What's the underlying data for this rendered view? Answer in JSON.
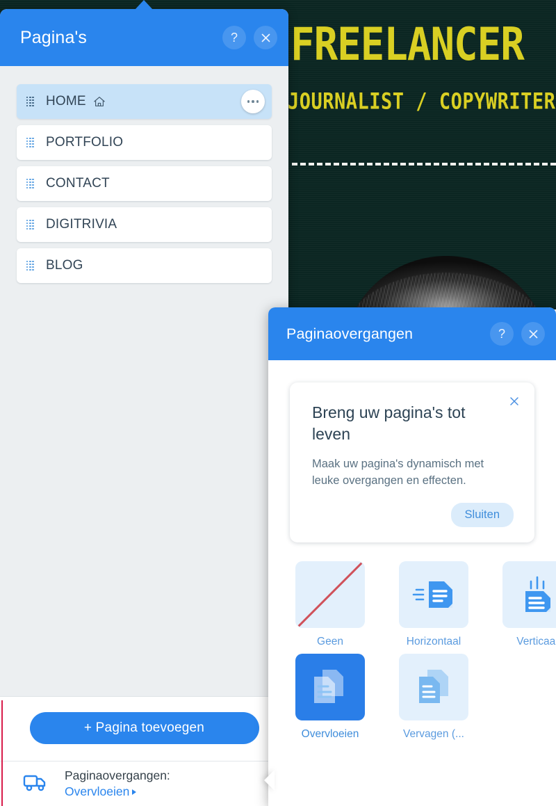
{
  "site": {
    "hero_title": "FREELANCER",
    "hero_subtitle": "JOURNALIST / COPYWRITER",
    "accent_yellow": "#d9cf23",
    "hero_bg": "#0b2622"
  },
  "pages_panel": {
    "title": "Pagina's",
    "help_label": "?",
    "close_label": "×",
    "items": [
      {
        "label": "HOME",
        "has_home_icon": true,
        "active": true
      },
      {
        "label": "PORTFOLIO",
        "has_home_icon": false,
        "active": false
      },
      {
        "label": "CONTACT",
        "has_home_icon": false,
        "active": false
      },
      {
        "label": "DIGITRIVIA",
        "has_home_icon": false,
        "active": false
      },
      {
        "label": "BLOG",
        "has_home_icon": false,
        "active": false
      }
    ],
    "add_page_label": "+ Pagina toevoegen",
    "footer": {
      "transitions_label": "Paginaovergangen:",
      "transitions_value": "Overvloeien"
    },
    "accent": "#2a85ed"
  },
  "transitions_panel": {
    "title": "Paginaovergangen",
    "help_label": "?",
    "close_label": "×",
    "promo": {
      "title": "Breng uw pagina's tot leven",
      "body": "Maak uw pagina's dynamisch met leuke overgangen en effecten.",
      "dismiss_label": "Sluiten"
    },
    "options": [
      {
        "label": "Geen",
        "icon": "no-transition-icon",
        "selected": false
      },
      {
        "label": "Horizontaal",
        "icon": "horizontal-slide-icon",
        "selected": false
      },
      {
        "label": "Verticaal",
        "icon": "vertical-slide-icon",
        "selected": false
      },
      {
        "label": "Overvloeien",
        "icon": "crossfade-icon",
        "selected": true
      },
      {
        "label": "Vervagen (...",
        "icon": "fade-icon",
        "selected": false
      }
    ],
    "accent": "#2a85ed"
  }
}
